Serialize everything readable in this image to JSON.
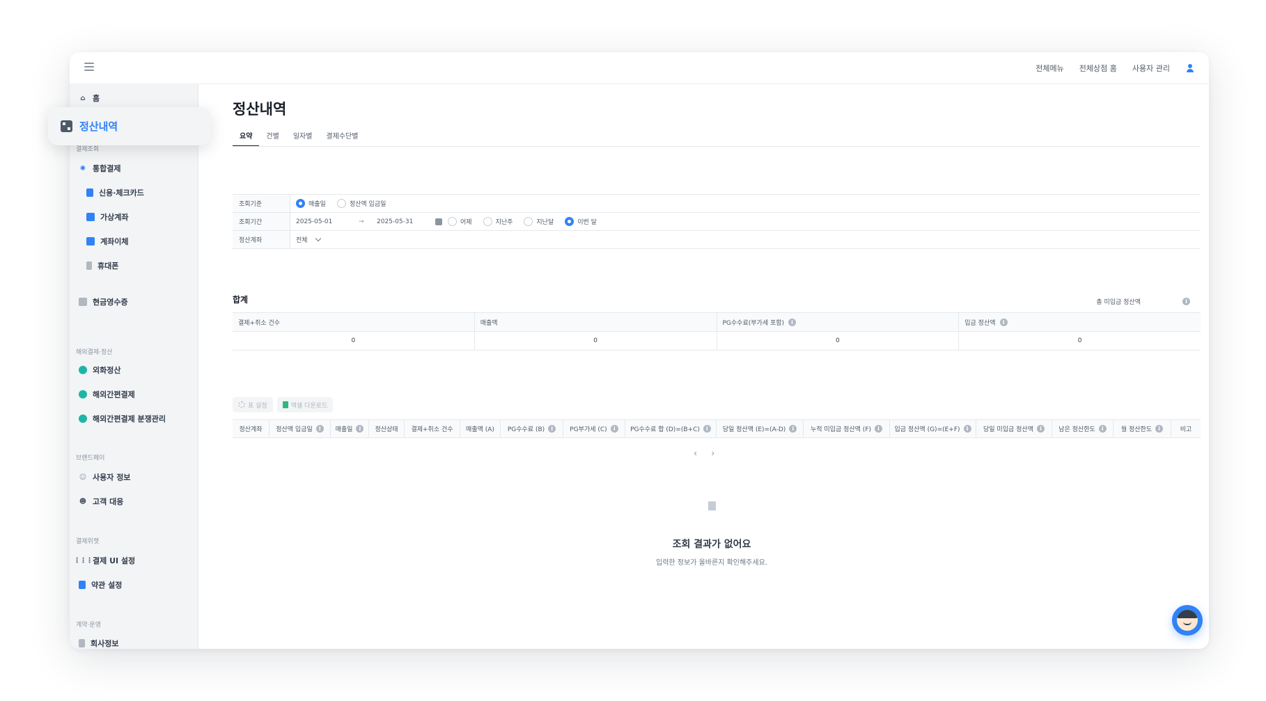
{
  "header": {
    "menu_icon": "hamburger-icon",
    "links": [
      "전체메뉴",
      "전체상점 홈",
      "사용자 관리"
    ],
    "user_icon": "user-icon"
  },
  "sidebar": {
    "home": "홈",
    "active_item": "정산내역",
    "sections": {
      "payment_inquiry": "결제조회",
      "overseas": "해외결제·정산",
      "brandpay": "브랜드페이",
      "widget": "결제위젯",
      "contract": "계약·운영"
    },
    "items": {
      "integrated": "통합결제",
      "card": "신용·체크카드",
      "virtual_account": "가상계좌",
      "transfer": "계좌이체",
      "phone": "휴대폰",
      "cash_receipt": "현금영수증",
      "fx": "외화정산",
      "overseas_simple": "해외간편결제",
      "overseas_dispute": "해외간편결제 분쟁관리",
      "user_info": "사용자 정보",
      "customer": "고객 대응",
      "ui_settings": "결제 UI 설정",
      "terms": "약관 설정",
      "company": "회사정보"
    }
  },
  "main": {
    "title": "정산내역",
    "tabs": [
      "요약",
      "건별",
      "일자별",
      "결제수단별"
    ],
    "filters": {
      "basis_label": "조회기준",
      "basis_options": [
        "매출일",
        "정산액 입금일"
      ],
      "period_label": "조회기간",
      "start_date": "2025-05-01",
      "arrow": "→",
      "end_date": "2025-05-31",
      "period_options": [
        "어제",
        "지난주",
        "지난달",
        "이번 달"
      ],
      "account_label": "정산계좌",
      "account_value": "전체"
    },
    "summary": {
      "title": "합계",
      "unpaid_label": "총 미입금 정산액",
      "headers": [
        "결제+취소 건수",
        "매출액",
        "PG수수료(부가세 포함)",
        "입금 정산액"
      ],
      "values": [
        "0",
        "0",
        "0",
        "0"
      ]
    },
    "tools": {
      "settings": "표 설정",
      "excel": "엑셀 다운로드"
    },
    "columns": [
      "정산계좌",
      "정산액 입금일",
      "매출일",
      "정산상태",
      "결제+취소 건수",
      "매출액 (A)",
      "PG수수료 (B)",
      "PG부가세 (C)",
      "PG수수료 합 (D)=(B+C)",
      "당일 정산액 (E)=(A-D)",
      "누적 미입금 정산액 (F)",
      "입금 정산액 (G)=(E+F)",
      "당일 미입금 정산액",
      "남은 정산한도",
      "월 정산한도",
      "비고"
    ],
    "pager": {
      "prev": "‹",
      "next": "›"
    },
    "empty": {
      "title": "조회 결과가 없어요",
      "subtitle": "입력한 정보가 올바른지 확인해주세요."
    }
  }
}
